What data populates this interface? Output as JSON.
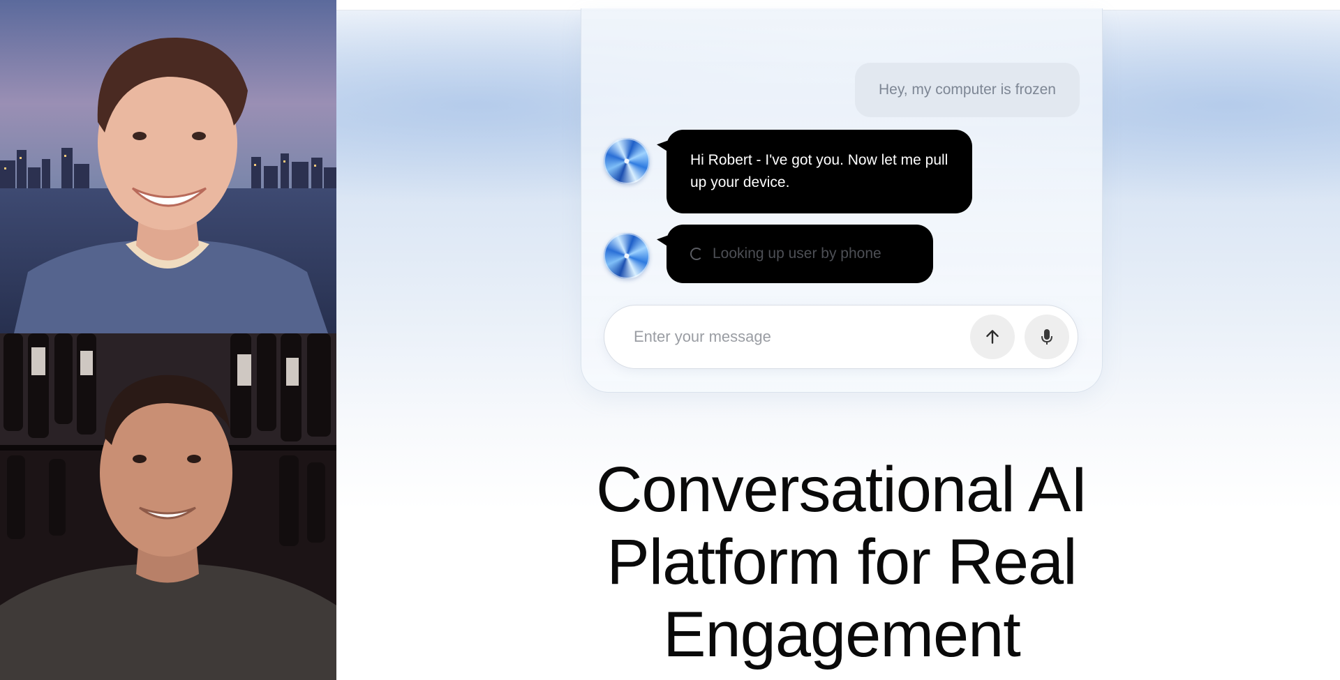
{
  "video_call": {
    "participants": [
      {
        "id": "participant-1"
      },
      {
        "id": "participant-2"
      }
    ]
  },
  "chat": {
    "user_message": "Hey, my computer is frozen",
    "bot_message": "Hi Robert - I've got you. Now let me pull up your device.",
    "bot_status": "Looking up user by phone",
    "input": {
      "placeholder": "Enter your message",
      "value": ""
    },
    "icons": {
      "avatar": "ai-orb-icon",
      "status": "spinner-icon",
      "send": "arrow-up-icon",
      "mic": "microphone-icon"
    }
  },
  "headline": {
    "line1": "Conversational AI",
    "line2": "Platform for Real",
    "line3": "Engagement"
  },
  "colors": {
    "bot_bubble": "#000000",
    "user_bubble": "#e2e8f0",
    "headline": "#0a0a0a",
    "accent_blue": "#2f7be0"
  }
}
